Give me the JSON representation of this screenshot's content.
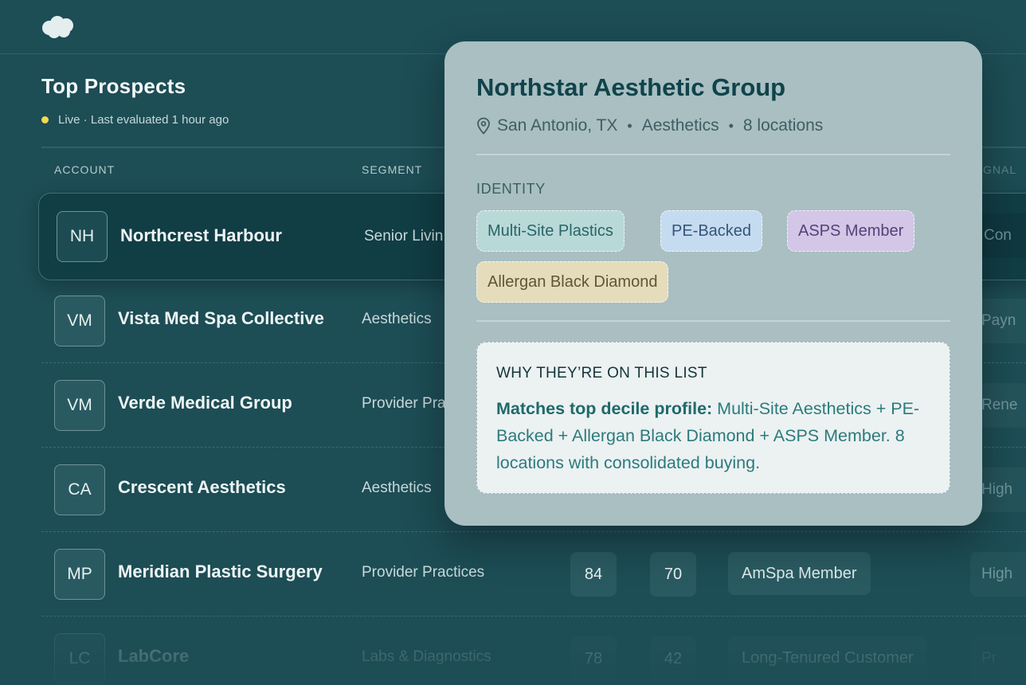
{
  "colors": {
    "background": "#1d4d55",
    "live_dot": "#f2d94e",
    "card": "#a9bfc2",
    "tag_multi_site": "#b8d9d8",
    "tag_pe_backed": "#c5dbf0",
    "tag_asps": "#d3c6e6",
    "tag_allergan": "#e5dcbc"
  },
  "icons": {
    "logo": "cloud-logo",
    "location": "map-pin-icon"
  },
  "header": {
    "title": "Top Prospects",
    "status": "Live · Last evaluated 1 hour ago"
  },
  "table": {
    "columns": {
      "account": "ACCOUNT",
      "segment": "SEGMENT",
      "signal": "GNAL"
    },
    "rows": [
      {
        "initials": "NH",
        "name": "Northcrest Harbour",
        "segment": "Senior Livin",
        "cut": "Con"
      },
      {
        "initials": "VM",
        "name": "Vista Med Spa Collective",
        "segment": "Aesthetics",
        "cut": "Payn"
      },
      {
        "initials": "VM",
        "name": "Verde Medical Group",
        "segment": "Provider Pra",
        "cut": "Rene"
      },
      {
        "initials": "CA",
        "name": "Crescent Aesthetics",
        "segment": "Aesthetics",
        "cut": "High"
      },
      {
        "initials": "MP",
        "name": "Meridian Plastic Surgery",
        "segment": "Provider Practices",
        "score1": "84",
        "score2": "70",
        "signal": "AmSpa Member",
        "cut": "High"
      },
      {
        "initials": "LC",
        "name": "LabCore",
        "segment": "Labs & Diagnostics",
        "score1": "78",
        "score2": "42",
        "signal": "Long-Tenured Customer",
        "cut": "Pr"
      }
    ]
  },
  "card": {
    "title": "Northstar Aesthetic Group",
    "location": "San Antonio, TX",
    "segment": "Aesthetics",
    "locations": "8 locations",
    "separator": "•",
    "identity_label": "IDENTITY",
    "tags": [
      "Multi-Site Plastics",
      "PE-Backed",
      "ASPS Member",
      "Allergan Black Diamond"
    ],
    "why_heading": "WHY THEY’RE ON THIS LIST",
    "why_lead": "Matches top decile profile:",
    "why_body": " Multi-Site Aesthetics + PE-Backed + Allergan Black Diamond + ASPS Member. 8 locations with consolidated buying."
  }
}
